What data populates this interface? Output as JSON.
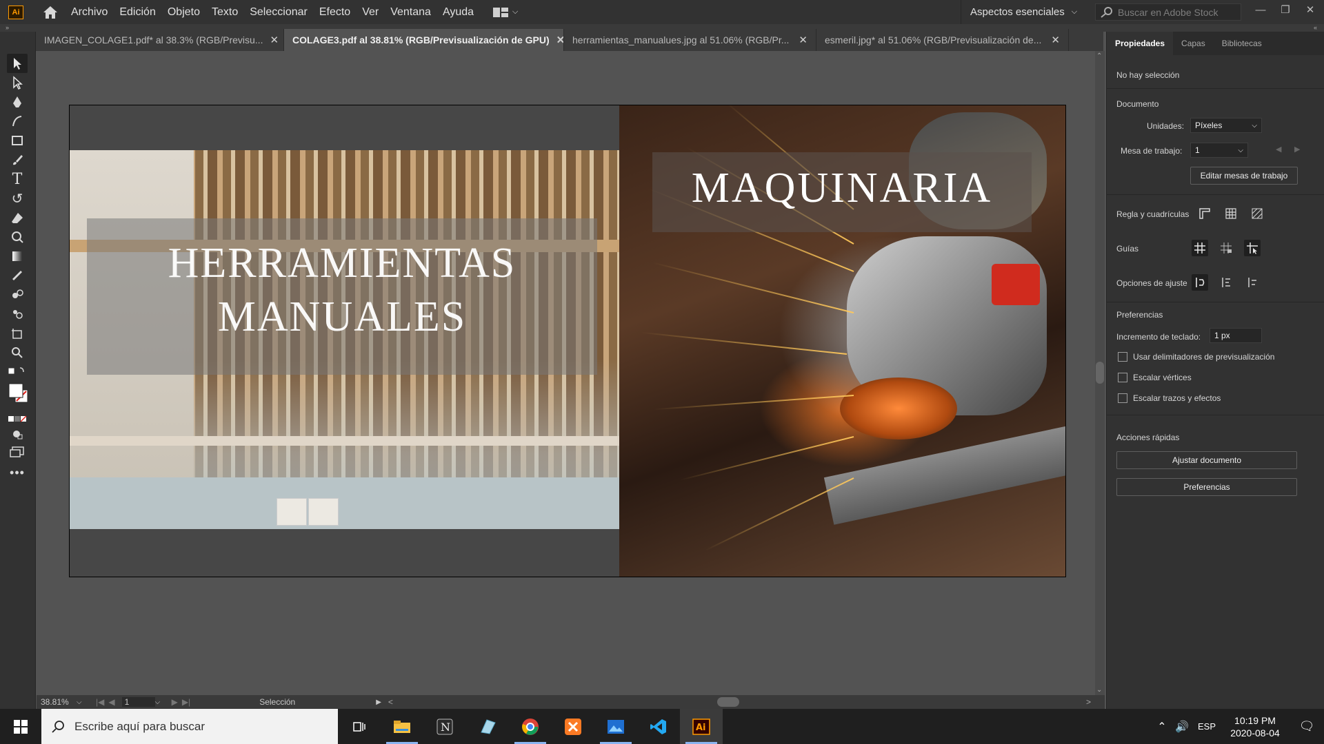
{
  "menubar": {
    "app_icon": "Ai",
    "items": [
      "Archivo",
      "Edición",
      "Objeto",
      "Texto",
      "Seleccionar",
      "Efecto",
      "Ver",
      "Ventana",
      "Ayuda"
    ],
    "workspace": "Aspectos esenciales",
    "stock_placeholder": "Buscar en Adobe Stock"
  },
  "tabs": [
    {
      "label": "IMAGEN_COLAGE1.pdf* al 38.3% (RGB/Previsu...",
      "active": false
    },
    {
      "label": "COLAGE3.pdf al 38.81% (RGB/Previsualización de GPU)",
      "active": true
    },
    {
      "label": "herramientas_manualues.jpg al 51.06% (RGB/Pr...",
      "active": false
    },
    {
      "label": "esmeril.jpg* al 51.06% (RGB/Previsualización de...",
      "active": false
    }
  ],
  "artboard": {
    "left_title_line1": "HERRAMIENTAS",
    "left_title_line2": "MANUALES",
    "right_title": "MAQUINARIA"
  },
  "status": {
    "zoom": "38.81%",
    "artboard_num": "1",
    "tool_name": "Selección"
  },
  "panel": {
    "tabs": [
      "Propiedades",
      "Capas",
      "Bibliotecas"
    ],
    "no_selection": "No hay selección",
    "documento": "Documento",
    "unidades_label": "Unidades:",
    "unidades_value": "Píxeles",
    "mesa_label": "Mesa de trabajo:",
    "mesa_value": "1",
    "editar_btn": "Editar mesas de trabajo",
    "regla_label": "Regla y cuadrículas",
    "guias_label": "Guías",
    "ajuste_label": "Opciones de ajuste",
    "preferencias_title": "Preferencias",
    "incremento_label": "Incremento de teclado:",
    "incremento_value": "1 px",
    "check1": "Usar delimitadores de previsualización",
    "check2": "Escalar vértices",
    "check3": "Escalar trazos y efectos",
    "acciones_title": "Acciones rápidas",
    "ajustar_btn": "Ajustar documento",
    "preferencias_btn": "Preferencias"
  },
  "taskbar": {
    "search_placeholder": "Escribe aquí para buscar",
    "lang": "ESP",
    "time": "10:19 PM",
    "date": "2020-08-04",
    "apps": [
      "task-view-icon",
      "file-explorer-icon",
      "notion-icon",
      "notes-icon",
      "chrome-icon",
      "xampp-icon",
      "photos-icon",
      "vscode-icon",
      "illustrator-icon"
    ]
  },
  "colors": {
    "accent": "#ff9a00",
    "ui_dark": "#323232",
    "canvas": "#535353"
  }
}
